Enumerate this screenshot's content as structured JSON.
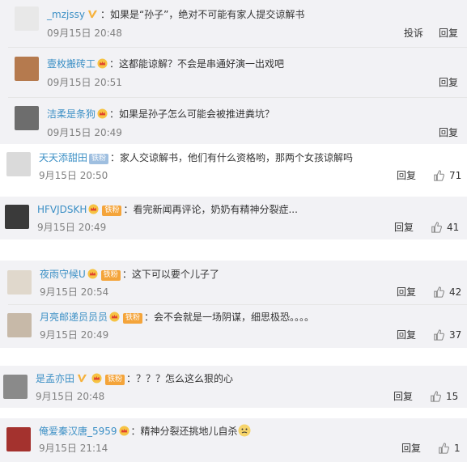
{
  "reply_label": "回复",
  "report_label": "投诉",
  "comments": [
    {
      "user": "_mzjssy",
      "text": "：如果是“孙子”，绝对不可能有家人提交谅解书",
      "time": "09月15日 20:48"
    },
    {
      "user": "壹枚搬砖工",
      "text": "：这都能谅解？不会是串通好演一出戏吧",
      "time": "09月15日 20:51"
    },
    {
      "user": "洁柔是条狗",
      "text": "：如果是孙子怎么可能会被推进粪坑？",
      "time": "09月15日 20:49"
    },
    {
      "user": "天天添甜田",
      "badge": "铁粉",
      "text": "：家人交谅解书，他们有什么资格哟，那两个女孩谅解吗",
      "time": "9月15日 20:50",
      "likes": "71"
    },
    {
      "user": "HFVJDSKH",
      "badge": "铁粉",
      "text": "：看完新闻再评论，奶奶有精神分裂症...",
      "time": "9月15日 20:49",
      "likes": "41"
    },
    {
      "user": "夜雨守候U",
      "badge": "铁粉",
      "text": "：这下可以要个儿子了",
      "time": "9月15日 20:54",
      "likes": "42"
    },
    {
      "user": "月亮邮递员员员",
      "badge": "铁粉",
      "text": "：会不会就是一场阴谋，细思极恐。。。。",
      "time": "9月15日 20:49",
      "likes": "37"
    },
    {
      "user": "是孟亦田",
      "badge": "铁粉",
      "text": "：？？？怎么这么狠的心",
      "time": "9月15日 20:48",
      "likes": "15"
    },
    {
      "user": "俺爱秦汉唐_5959",
      "text": "：精神分裂还挑地儿自杀",
      "time": "9月15日 21:14",
      "likes": "1"
    }
  ],
  "colors": {
    "username": "#eb7350",
    "username_blue": "#3b8fc5",
    "panel": "#f2f2f5",
    "fan_badge": "#f4a43a"
  }
}
